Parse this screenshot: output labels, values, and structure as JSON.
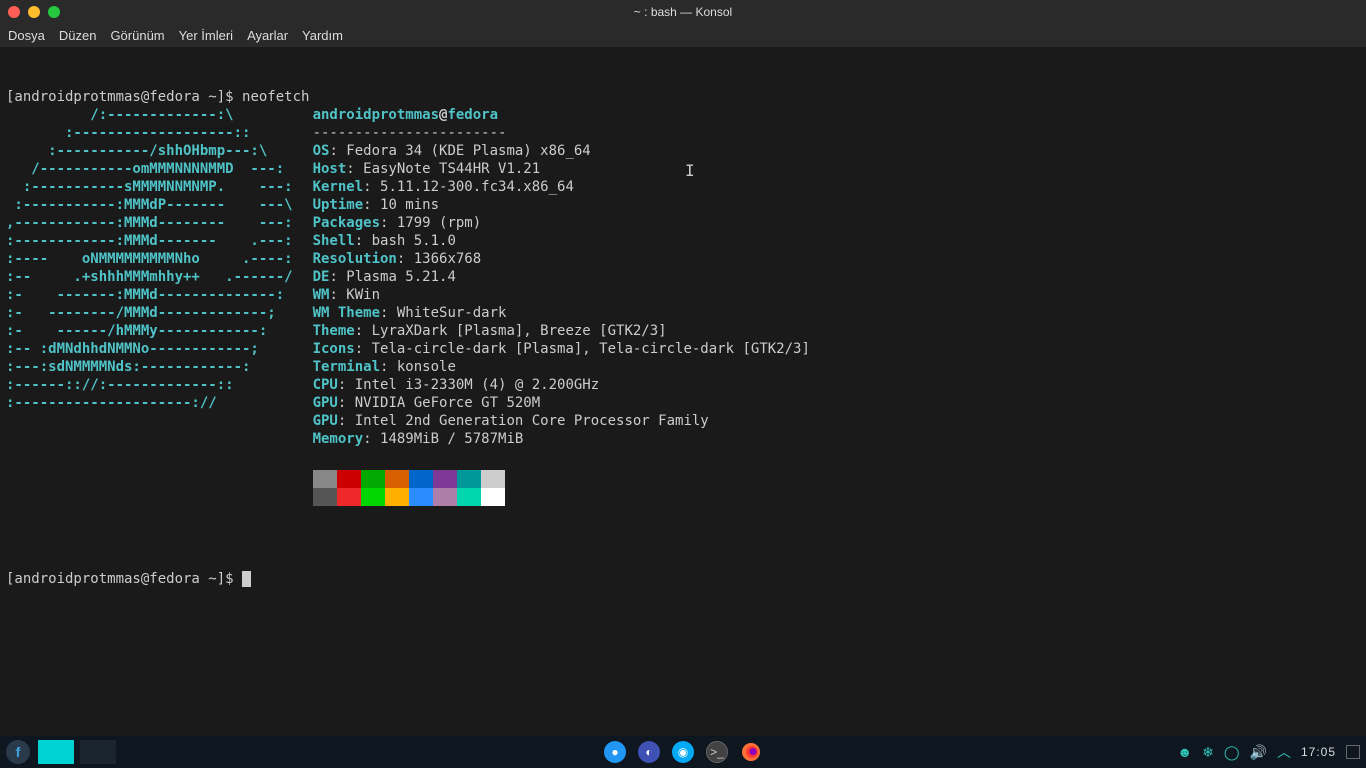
{
  "window": {
    "title": "~ : bash — Konsol"
  },
  "menubar": {
    "items": [
      "Dosya",
      "Düzen",
      "Görünüm",
      "Yer İmleri",
      "Ayarlar",
      "Yardım"
    ]
  },
  "prompt1": {
    "full": "[androidprotmmas@fedora ~]$ ",
    "command": "neofetch"
  },
  "prompt2": {
    "full": "[androidprotmmas@fedora ~]$ "
  },
  "ascii": [
    "          /:-------------:\\",
    "       :-------------------::",
    "     :-----------/shhOHbmp---:\\",
    "   /-----------omMMMNNNNMMD  ---:",
    "  :-----------sMMMMNNMNMP.    ---:",
    " :-----------:MMMdP-------    ---\\",
    ",------------:MMMd--------    ---:",
    ":------------:MMMd-------    .---:",
    ":----    oNMMMMMMMMMNho     .----:",
    ":--     .+shhhMMMmhhy++   .------/",
    ":-    -------:MMMd--------------:",
    ":-   --------/MMMd-------------;",
    ":-    ------/hMMMy------------:",
    ":-- :dMNdhhdNMMNo------------;",
    ":---:sdNMMMMNds:------------:",
    ":------:://:-------------::",
    ":---------------------://"
  ],
  "neofetch": {
    "user": "androidprotmmas",
    "at": "@",
    "host": "fedora",
    "dashes": "-----------------------",
    "info": [
      {
        "key": "OS",
        "val": ": Fedora 34 (KDE Plasma) x86_64"
      },
      {
        "key": "Host",
        "val": ": EasyNote TS44HR V1.21"
      },
      {
        "key": "Kernel",
        "val": ": 5.11.12-300.fc34.x86_64"
      },
      {
        "key": "Uptime",
        "val": ": 10 mins"
      },
      {
        "key": "Packages",
        "val": ": 1799 (rpm)"
      },
      {
        "key": "Shell",
        "val": ": bash 5.1.0"
      },
      {
        "key": "Resolution",
        "val": ": 1366x768"
      },
      {
        "key": "DE",
        "val": ": Plasma 5.21.4"
      },
      {
        "key": "WM",
        "val": ": KWin"
      },
      {
        "key": "WM Theme",
        "val": ": WhiteSur-dark"
      },
      {
        "key": "Theme",
        "val": ": LyraXDark [Plasma], Breeze [GTK2/3]"
      },
      {
        "key": "Icons",
        "val": ": Tela-circle-dark [Plasma], Tela-circle-dark [GTK2/3]"
      },
      {
        "key": "Terminal",
        "val": ": konsole"
      },
      {
        "key": "CPU",
        "val": ": Intel i3-2330M (4) @ 2.200GHz"
      },
      {
        "key": "GPU",
        "val": ": NVIDIA GeForce GT 520M"
      },
      {
        "key": "GPU",
        "val": ": Intel 2nd Generation Core Processor Family"
      },
      {
        "key": "Memory",
        "val": ": 1489MiB / 5787MiB"
      }
    ]
  },
  "colors_row1": [
    "#888888",
    "#cc0000",
    "#00a800",
    "#d75f00",
    "#0066cc",
    "#7e3996",
    "#009999",
    "#cccccc"
  ],
  "colors_row2": [
    "#555555",
    "#ef2929",
    "#00d700",
    "#ffaf00",
    "#2b8cff",
    "#ad7fa8",
    "#00d7af",
    "#ffffff"
  ],
  "clock": "17:05"
}
